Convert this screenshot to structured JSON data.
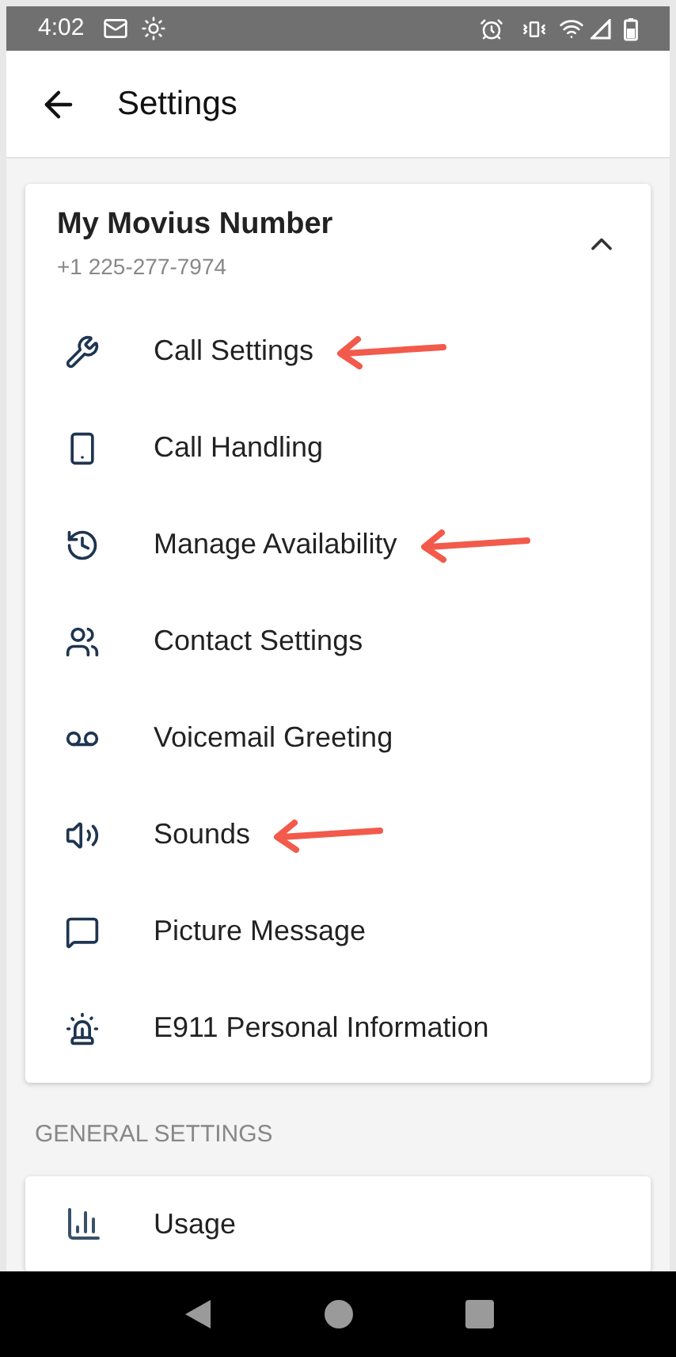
{
  "status_bar": {
    "time": "4:02"
  },
  "app_bar": {
    "title": "Settings"
  },
  "account": {
    "title": "My Movius Number",
    "number": "+1 225-277-7974",
    "expanded": true,
    "items": [
      {
        "label": "Call Settings",
        "highlighted": true
      },
      {
        "label": "Call Handling",
        "highlighted": false
      },
      {
        "label": "Manage Availability",
        "highlighted": true
      },
      {
        "label": "Contact Settings",
        "highlighted": false
      },
      {
        "label": "Voicemail Greeting",
        "highlighted": false
      },
      {
        "label": "Sounds",
        "highlighted": true
      },
      {
        "label": "Picture Message",
        "highlighted": false
      },
      {
        "label": "E911 Personal Information",
        "highlighted": false
      }
    ]
  },
  "general": {
    "heading": "GENERAL SETTINGS",
    "items": [
      {
        "label": "Usage"
      }
    ]
  }
}
